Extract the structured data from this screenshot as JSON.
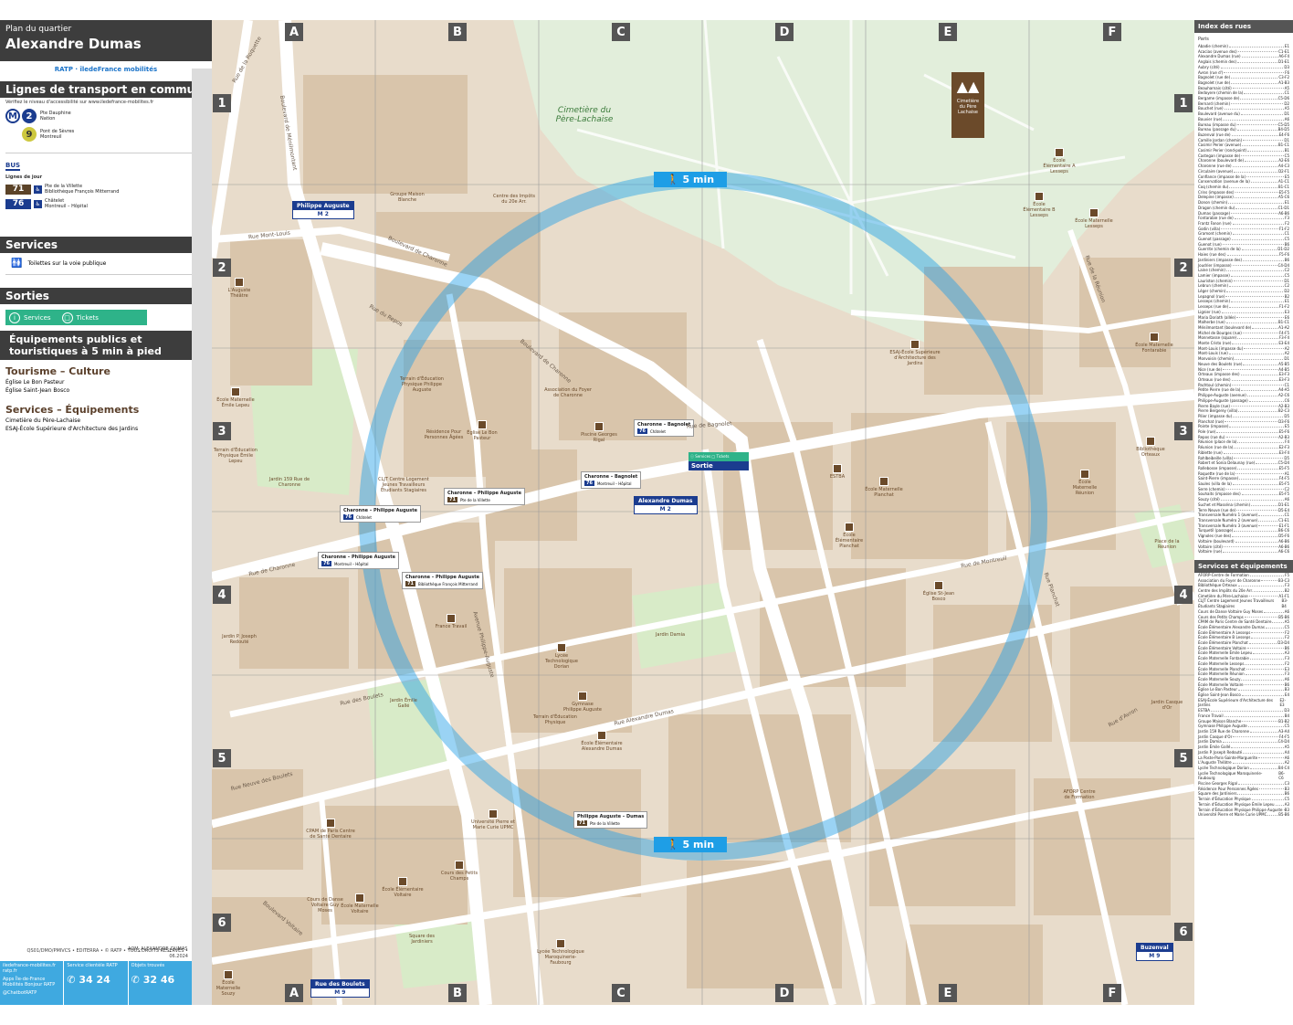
{
  "header": {
    "subtitle": "Plan du quartier",
    "title": "Alexandre Dumas",
    "logos": "RATP  ·  îledeFrance mobilités"
  },
  "transport": {
    "title": "Lignes de transport en commun",
    "note": "Vérifiez le niveau d'accessibilité sur www.iledefrance-mobilites.fr",
    "metro_2": {
      "line": "2",
      "dest1": "Pte Dauphine",
      "dest2": "Nation",
      "color": "#1b3c8f"
    },
    "metro_9": {
      "line": "9",
      "dest1": "Pont de Sèvres",
      "dest2": "Montreuil",
      "color": "#cdc83f"
    },
    "bus_label": "BUS",
    "day_lines": "Lignes de jour",
    "bus_71": {
      "line": "71",
      "dest1": "Pte de la Villette",
      "dest2": "Bibliothèque François Mitterrand",
      "color": "#5b4328"
    },
    "bus_76": {
      "line": "76",
      "dest1": "Châtelet",
      "dest2": "Montreuil – Hôpital",
      "color": "#1b3c8f"
    }
  },
  "services": {
    "title": "Services",
    "toilets": "Toilettes sur la voie publique"
  },
  "exits": {
    "title": "Sorties",
    "services": "Services",
    "tickets": "Tickets"
  },
  "equipements": {
    "title": "Équipements publics et touristiques à 5 min à pied",
    "tourism_title": "Tourisme – Culture",
    "tourism": [
      {
        "name": "Église Le Bon Pasteur",
        "code": "A3"
      },
      {
        "name": "Église Saint-Jean Bosco",
        "code": "E4"
      }
    ],
    "services_title": "Services – Équipements",
    "services": [
      {
        "name": "Cimetière du Père-Lachaise",
        "code": "B1"
      },
      {
        "name": "ESAJ-École Supérieure d'Architecture des Jardins",
        "code": "E3"
      }
    ]
  },
  "footer": {
    "page_code": "AQM_ALEXANDRE_DUMAS",
    "copyright": "QS01/DMO/PMIVCS • EDITERRA • © RATP • TOUS DROITS RÉSERVÉS • 06.2024",
    "web": "iledefrance-mobilites.fr ratp.fr",
    "apps": "Apps Île-de-France Mobilités Bonjour RATP",
    "twitter": "@ChatbotRATP",
    "service_label": "Service clientèle RATP",
    "phone1": "34 24",
    "lost_label": "Objets trouvés",
    "phone2": "32 46"
  },
  "map": {
    "columns": [
      "A",
      "B",
      "C",
      "D",
      "E",
      "F"
    ],
    "rows": [
      "1",
      "2",
      "3",
      "4",
      "5",
      "6"
    ],
    "walk_label": "5 min",
    "cemetery": "Cimetière du Père-Lachaise",
    "cemetery_sign": "Cimetière du Père Lachaise",
    "colors": {
      "ground": "#e8dccb",
      "block": "#d9c5ab",
      "street": "#ffffff",
      "park": "#d8ebc8",
      "cemetery": "#e2eedb",
      "walk": "#1e9ee6"
    },
    "stations": [
      {
        "name": "Alexandre Dumas",
        "line": "M 2"
      },
      {
        "name": "Philippe Auguste",
        "line": "M 2"
      },
      {
        "name": "Rue des Boulets",
        "line": "M 9"
      },
      {
        "name": "Buzenval",
        "line": "M 9"
      }
    ],
    "bus_stops": [
      {
        "name": "Charonne – Bagnolet",
        "line": "76",
        "dir": "Châtelet"
      },
      {
        "name": "Charonne – Bagnolet",
        "line": "76",
        "dir": "Montreuil – Hôpital"
      },
      {
        "name": "Charonne – Philippe Auguste",
        "line": "71",
        "dir": "Pte de la Villette"
      },
      {
        "name": "Charonne – Philippe Auguste",
        "line": "76",
        "dir": "Châtelet"
      },
      {
        "name": "Charonne – Philippe Auguste",
        "line": "76",
        "dir": "Montreuil – Hôpital"
      },
      {
        "name": "Charonne – Philippe Auguste",
        "line": "71",
        "dir": "Bibliothèque François Mitterrand"
      },
      {
        "name": "Philippe Auguste – Dumas",
        "line": "71",
        "dir": "Pte de la Villette"
      }
    ],
    "sortie": {
      "services": "Services",
      "tickets": "Tickets",
      "label": "Sortie"
    },
    "streets": [
      "Boulevard de Ménilmontant",
      "Rue de Bagnolet",
      "Rue de Charonne",
      "Boulevard de Charonne",
      "Avenue Philippe-Auguste",
      "Boulevard de Charonne",
      "Rue des Boulets",
      "Rue de Montreuil",
      "Rue Alexandre Dumas",
      "Boulevard Voltaire",
      "Rue Planchat",
      "Rue de la Réunion",
      "Rue d'Avron",
      "Rue de la Roquette",
      "Rue Neuve des Boulets",
      "Rue Mont-Louis",
      "Rue du Repos"
    ],
    "pois": [
      "Groupe Maison Blanche",
      "Centre des Impôts du 20e Arr.",
      "L'Auguste Théâtre",
      "Terrain d'Éducation Physique Philippe Auguste",
      "Résidence Pour Personnes Âgées",
      "Église Le Bon Pasteur",
      "Association du Foyer de Charonne",
      "Piscine Georges Rigal",
      "CLJT Centre Logement Jeunes Travailleurs Étudiants Stagiaires",
      "Jardin 159 Rue de Charonne",
      "École Maternelle Émile Lepeu",
      "Terrain d'Éducation Physique Émile Lepeu",
      "ESAJ-École Supérieure d'Architecture des Jardins",
      "ESTBA",
      "École Maternelle Planchat",
      "École Élémentaire Planchat",
      "Église St-Jean Bosco",
      "Jardin P. Joseph Redouté",
      "France Travail",
      "Lycée Technologique Dorian",
      "Jardin Damia",
      "Gymnase Philippe Auguste",
      "Terrain d'Éducation Physique",
      "École Élémentaire Alexandre Dumas",
      "Jardin Émile Gallé",
      "Université Pierre et Marie Curie UPMC",
      "Cours des Petits Champs",
      "CPAM de Paris Centre de Santé Dentaire",
      "École Élémentaire Voltaire",
      "Cours de Danse Voltaire Guy Moses",
      "École Maternelle Voltaire",
      "Square des Jardiniers",
      "Lycée Technologique Maroquinerie-Faubourg",
      "AFORP Centre de Formation",
      "École Maternelle Réunion",
      "Bibliothèque Orteaux",
      "École Maternelle Fontarabie",
      "École Élémentaire A Lesseps",
      "École Élémentaire B Lesseps",
      "École Maternelle Lesseps",
      "Place de la Réunion",
      "Jardin Casque d'Or",
      "École Maternelle Souzy"
    ]
  },
  "index": {
    "title": "Index des rues",
    "city": "Paris",
    "streets": [
      [
        "Abadie (chemin)",
        "E1"
      ],
      [
        "Acacias (avenue des)",
        "C1-E1"
      ],
      [
        "Alexandre Dumas (rue)",
        "A6-F4"
      ],
      [
        "Anglais (chemin des)",
        "D1-E1"
      ],
      [
        "Aubry (cité)",
        "D3"
      ],
      [
        "Avron (rue d')",
        "F6"
      ],
      [
        "Bagnolet (rue de)",
        "C3-F2"
      ],
      [
        "Bagnolet (rue de)",
        "A1-B3"
      ],
      [
        "Beauharnais (cité)",
        "A5"
      ],
      [
        "Bedoyere (chemin de la)",
        "C1"
      ],
      [
        "Bergame (impasse de)",
        "C5-D6"
      ],
      [
        "Bernard (chemin)",
        "D2"
      ],
      [
        "Bouchet (rue)",
        "A5"
      ],
      [
        "Boulevard (avenue du)",
        "D1"
      ],
      [
        "Bouvier (rue)",
        "A6"
      ],
      [
        "Bureau (impasse du)",
        "C5-D5"
      ],
      [
        "Bureau (passage du)",
        "B4-D5"
      ],
      [
        "Buzenval (rue de)",
        "E4-F6"
      ],
      [
        "Camille Jordan (chemin)",
        "D1"
      ],
      [
        "Casimir Perier (avenue)",
        "B1-C1"
      ],
      [
        "Casimir Perier (rond-point)",
        "B1"
      ],
      [
        "Castegan (impasse de)",
        "C5"
      ],
      [
        "Charonne (boulevard de)",
        "A2-E6"
      ],
      [
        "Charonne (rue de)",
        "A4-C3"
      ],
      [
        "Circulaire (avenue)",
        "D2-F1"
      ],
      [
        "Confiance (impasse de la)",
        "E5"
      ],
      [
        "Conservation (avenue de la)",
        "A1-C1"
      ],
      [
        "Coq (chemin du)",
        "B1-C1"
      ],
      [
        "Crins (impasse des)",
        "E5-F5"
      ],
      [
        "Delepine (impasse)",
        "A5-C6"
      ],
      [
        "Donon (chemin)",
        "E1"
      ],
      [
        "Dragon (chemin du)",
        "C1-D1"
      ],
      [
        "Dumas (passage)",
        "A6-B6"
      ],
      [
        "Fontarabie (rue de)",
        "F3"
      ],
      [
        "Frantz Fanon (rue)",
        "F2"
      ],
      [
        "Godin (villa)",
        "F1-F2"
      ],
      [
        "Gramont (chemin)",
        "C1"
      ],
      [
        "Guenot (passage)",
        "C5"
      ],
      [
        "Guenot (rue)",
        "B6"
      ],
      [
        "Guerrite (chemin de la)",
        "D1-D2"
      ],
      [
        "Haies (rue des)",
        "F5-F6"
      ],
      [
        "Jardiniers (impasse des)",
        "B6"
      ],
      [
        "Joudrier (impasse)",
        "C4-D4"
      ],
      [
        "Laine (chemin)",
        "C2"
      ],
      [
        "Lamier (impasse)",
        "C5"
      ],
      [
        "Lauriston (chemin)",
        "D1"
      ],
      [
        "Lebrun (chemin)",
        "C2"
      ],
      [
        "Léger (chemin)",
        "D2"
      ],
      [
        "Lepagnol (rue)",
        "B2"
      ],
      [
        "Lesseps (chemin)",
        "E1"
      ],
      [
        "Lesseps (rue de)",
        "F1-F2"
      ],
      [
        "Lignier (rue)",
        "E3"
      ],
      [
        "Maria Doriath (allée)",
        "E6"
      ],
      [
        "Malherbe (rue)",
        "B1-C1"
      ],
      [
        "Ménilmontant (boulevard de)",
        "A1-A2"
      ],
      [
        "Michel de Bourges (rue)",
        "F4-F5"
      ],
      [
        "Monnetasse (square)",
        "F3-F4"
      ],
      [
        "Monte Cristo (rue)",
        "E3-E4"
      ],
      [
        "Mont-Louis (impasse du)",
        "A2"
      ],
      [
        "Mont-Louis (rue)",
        "A2"
      ],
      [
        "Monvoisin (chemin)",
        "D1"
      ],
      [
        "Neuve des Boulets (rue)",
        "A5-B5"
      ],
      [
        "Nice (rue de)",
        "A4-B5"
      ],
      [
        "Orteaux (impasse des)",
        "E3-F3"
      ],
      [
        "Orteaux (rue des)",
        "E3-F3"
      ],
      [
        "Pachtoul (chemin)",
        "C1"
      ],
      [
        "Petite Pierre (rue de la)",
        "A4-A5"
      ],
      [
        "Philippe-Auguste (avenue)",
        "A2-C6"
      ],
      [
        "Philippe-Auguste (passage)",
        "C6"
      ],
      [
        "Pierre Bayle (rue)",
        "A2-B3"
      ],
      [
        "Pierre Bergerey (villa)",
        "B2-C3"
      ],
      [
        "Pilier (impasse du)",
        "D5"
      ],
      [
        "Planchat (rue)",
        "D3-F6"
      ],
      [
        "Pointe (impasse)",
        "E5"
      ],
      [
        "Pole (rue)",
        "E5-F6"
      ],
      [
        "Repos (rue du)",
        "A2-B3"
      ],
      [
        "Réunion (place de la)",
        "F4"
      ],
      [
        "Réunion (rue de la)",
        "E2-F3"
      ],
      [
        "Riblette (rue)",
        "E3-F4"
      ],
      [
        "Rohlbeibeille (villa)",
        "D5"
      ],
      [
        "Robert et Sonia Delaunay (rue)",
        "C5-D4"
      ],
      [
        "Rollebosse (impasse)",
        "E5-F5"
      ],
      [
        "Roquette (rue de la)",
        "A1"
      ],
      [
        "Saint-Pierre (impasse)",
        "F4-F5"
      ],
      [
        "Saules (villa de la)",
        "E5-F5"
      ],
      [
        "Serre (chemin)",
        "C2"
      ],
      [
        "Souhaits (impasse des)",
        "E5-F5"
      ],
      [
        "Souzy (cité)",
        "A6"
      ],
      [
        "Suchet et Masséna (chemin)",
        "D1-E1"
      ],
      [
        "Terre Neuve (rue de)",
        "D5-E4"
      ],
      [
        "Transversale Numéro 1 (avenue)",
        "C1"
      ],
      [
        "Transversale Numéro 2 (avenue)",
        "C1-E1"
      ],
      [
        "Transversale Numéro 3 (avenue)",
        "E1-F1"
      ],
      [
        "Turquetil (passage)",
        "B6-C6"
      ],
      [
        "Vignoles (rue des)",
        "D5-F6"
      ],
      [
        "Voltaire (boulevard)",
        "A6-B6"
      ],
      [
        "Voltaire (cité)",
        "A6-B6"
      ],
      [
        "Voltaire (rue)",
        "A6-C6"
      ]
    ],
    "equip_title": "Services et équipements",
    "equipements": [
      [
        "AFORP-Centre de Formation",
        "F5"
      ],
      [
        "Association du Foyer de Charonne",
        "B3-C3"
      ],
      [
        "Bibliothèque Orteaux",
        "F3"
      ],
      [
        "Centre des Impôts du 20e Arr.",
        "B2"
      ],
      [
        "Cimetière du Père-Lachaise",
        "A1-F1"
      ],
      [
        "CLJT Centre Logement Jeunes Travailleurs Étudiants Stagiaires",
        "B3-B4"
      ],
      [
        "Cours de Danse Voltaire Guy Moses",
        "A6"
      ],
      [
        "Cours des Petits Champs",
        "B5-B6"
      ],
      [
        "CPAM de Paris Centre de Santé Dentaire",
        "A5"
      ],
      [
        "École Élémentaire Alexandre Dumas",
        "C5"
      ],
      [
        "École Élémentaire A Lesseps",
        "F2"
      ],
      [
        "École Élémentaire B Lesseps",
        "F2"
      ],
      [
        "École Élémentaire Planchat",
        "D3-D4"
      ],
      [
        "École Élémentaire Voltaire",
        "B6"
      ],
      [
        "École Maternelle Émile Lepeu",
        "A3"
      ],
      [
        "École Maternelle Fontarabie",
        "F3"
      ],
      [
        "École Maternelle Lesseps",
        "F2"
      ],
      [
        "École Maternelle Planchat",
        "E3"
      ],
      [
        "École Maternelle Réunion",
        "F3"
      ],
      [
        "École Maternelle Souzy",
        "A6"
      ],
      [
        "École Maternelle Voltaire",
        "B6"
      ],
      [
        "Église Le Bon Pasteur",
        "B3"
      ],
      [
        "Église Saint-Jean Bosco",
        "E4"
      ],
      [
        "ESAJ-École Supérieure d'Architecture des Jardins",
        "E2-E3"
      ],
      [
        "ESTBA",
        "D3"
      ],
      [
        "France Travail",
        "B4"
      ],
      [
        "Groupe Maison Blanche",
        "B1-B2"
      ],
      [
        "Gymnase Philippe Auguste",
        "C5"
      ],
      [
        "Jardin 159 Rue de Charonne",
        "A3-A4"
      ],
      [
        "Jardin Casque d'Or",
        "F4-F5"
      ],
      [
        "Jardin Damia",
        "C4-D4"
      ],
      [
        "Jardin Émile Gallé",
        "A5"
      ],
      [
        "Jardin P. Joseph Redouté",
        "A4"
      ],
      [
        "La Poste-Paris-Sainte-Marguerite",
        "A6"
      ],
      [
        "L'Auguste Théâtre",
        "A2"
      ],
      [
        "Lycée Technologique Dorian",
        "B4-C4"
      ],
      [
        "Lycée Technologique Maroquinerie-Faubourg",
        "B6-C6"
      ],
      [
        "Piscine Georges Rigal",
        "C3"
      ],
      [
        "Résidence Pour Personnes Âgées",
        "B3"
      ],
      [
        "Square des Jardiniers",
        "B6"
      ],
      [
        "Terrain d'Éducation Physique",
        "C5"
      ],
      [
        "Terrain d'Éducation Physique Émile Lepeu",
        "A3"
      ],
      [
        "Terrain d'Éducation Physique Philippe Auguste",
        "B3"
      ],
      [
        "Université Pierre et Marie Curie UPMC",
        "B5-B6"
      ]
    ]
  }
}
